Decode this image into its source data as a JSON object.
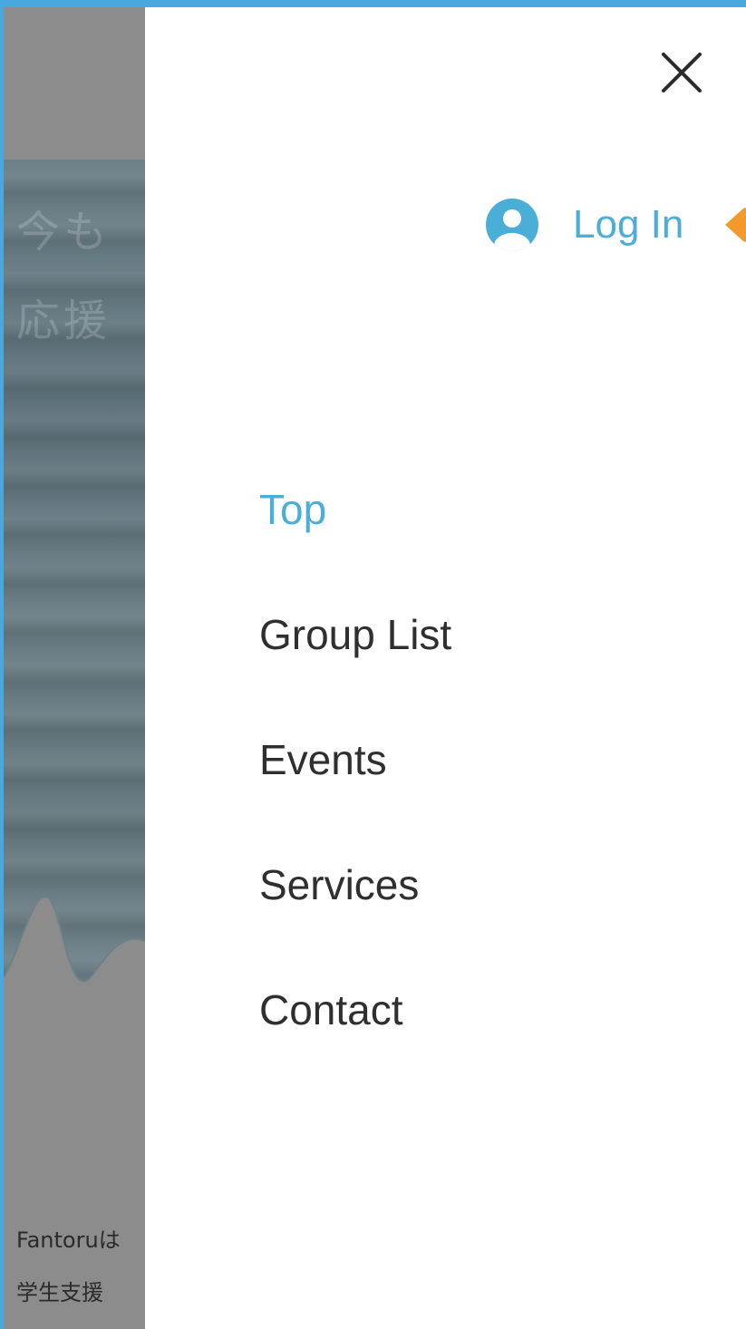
{
  "background": {
    "hero_line1": "今も",
    "hero_line2": "応援",
    "footer_line1": "Fantoruは",
    "footer_line2": "学生支援"
  },
  "drawer": {
    "close_icon": "close-icon",
    "login": {
      "icon": "user-avatar-icon",
      "label": "Log In"
    },
    "menu": [
      {
        "label": "Top",
        "active": true
      },
      {
        "label": "Group List",
        "active": false
      },
      {
        "label": "Events",
        "active": false
      },
      {
        "label": "Services",
        "active": false
      },
      {
        "label": "Contact",
        "active": false
      }
    ]
  },
  "colors": {
    "accent": "#4aaed6",
    "frame": "#4aa8e0",
    "highlight_arrow": "#f39a2b",
    "menu_text": "#2f2f2f"
  }
}
